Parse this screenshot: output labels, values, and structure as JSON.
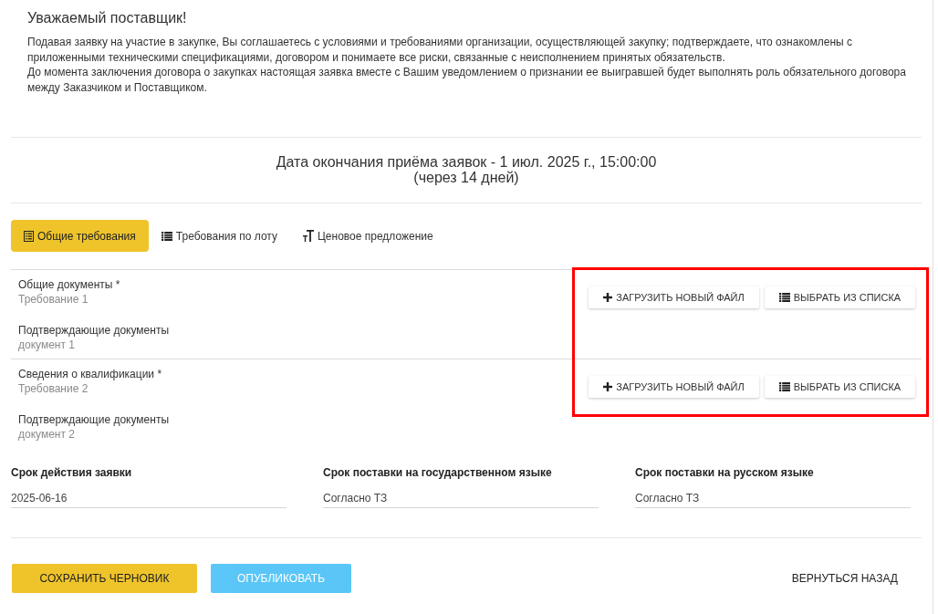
{
  "notice": {
    "title": "Уважаемый поставщик!",
    "paragraphs": [
      "Подавая заявку на участие в закупке, Вы соглашаетесь с условиями и требованиями организации, осуществляющей закупку; подтверждаете, что ознакомлены с приложенными техническими спецификациями, договором и понимаете все риски, связанные с неисполнением принятых обязательств.",
      "До момента заключения договора о закупках настоящая заявка вместе с Вашим уведомлением о признании ее выигравшей будет выполнять роль обязательного договора между Заказчиком и Поставщиком."
    ]
  },
  "deadline": {
    "text": "Дата окончания приёма заявок - 1 июл. 2025 г., 15:00:00",
    "remaining": "(через 14 дней)"
  },
  "tabs": [
    {
      "kind": "general",
      "label": "Общие требования",
      "selected": true
    },
    {
      "kind": "lot",
      "label": "Требования по лоту",
      "selected": false
    },
    {
      "kind": "price",
      "label": "Ценовое предложение",
      "selected": false
    }
  ],
  "requirements": [
    {
      "title": "Общие документы *",
      "subtitle": "Требование 1",
      "documents_label": "Подтверждающие документы",
      "document": "документ 1",
      "actions": [
        {
          "kind": "upload",
          "label": "ЗАГРУЗИТЬ НОВЫЙ ФАЙЛ"
        },
        {
          "kind": "choose",
          "label": "ВЫБРАТЬ ИЗ СПИСКА"
        }
      ]
    },
    {
      "title": "Сведения о квалификации *",
      "subtitle": "Требование 2",
      "documents_label": "Подтверждающие документы",
      "document": "документ 2",
      "actions": [
        {
          "kind": "upload",
          "label": "ЗАГРУЗИТЬ НОВЫЙ ФАЙЛ"
        },
        {
          "kind": "choose",
          "label": "ВЫБРАТЬ ИЗ СПИСКА"
        }
      ]
    }
  ],
  "annotation": {
    "kind": "frame"
  },
  "fields": [
    {
      "label": "Срок действия заявки",
      "value": "2025-06-16"
    },
    {
      "label": "Срок поставки на государственном языке",
      "value": "Согласно ТЗ"
    },
    {
      "label": "Срок поставки на русском языке",
      "value": "Согласно ТЗ"
    }
  ],
  "buttons": [
    {
      "kind": "save",
      "label": "СОХРАНИТЬ ЧЕРНОВИК",
      "disabled": false
    },
    {
      "kind": "publish",
      "label": "ОПУБЛИКОВАТЬ",
      "disabled": true
    },
    {
      "kind": "back",
      "label": "ВЕРНУТЬСЯ НАЗАД",
      "disabled": false
    }
  ]
}
